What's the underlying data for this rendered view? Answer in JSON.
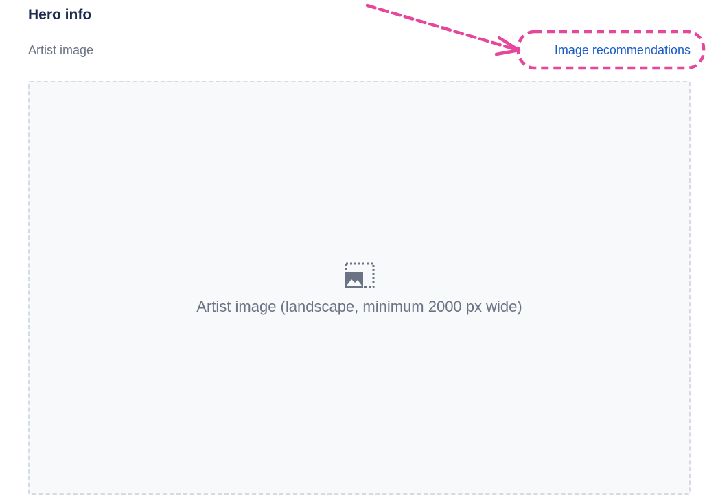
{
  "section": {
    "title": "Hero info"
  },
  "field": {
    "label": "Artist image",
    "link_label": "Image recommendations"
  },
  "dropzone": {
    "icon": "image-placeholder-icon",
    "text": "Artist image (landscape, minimum 2000 px wide)"
  },
  "annotation": {
    "color": "#e4479b"
  },
  "colors": {
    "title": "#1b2a4e",
    "muted": "#6b7385",
    "link": "#1a5cc7",
    "dropzone_bg": "#f8f9fb",
    "dropzone_border": "#d6dae2"
  }
}
